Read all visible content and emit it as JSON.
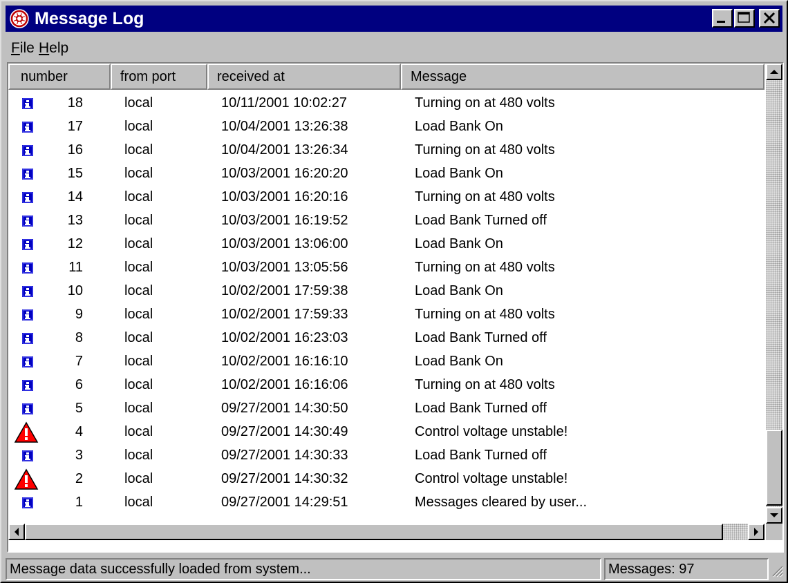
{
  "window": {
    "title": "Message Log"
  },
  "title_buttons": {
    "minimize": "minimize",
    "maximize": "maximize",
    "close": "close"
  },
  "menu": [
    {
      "label": "File",
      "accel": "F",
      "rest": "ile"
    },
    {
      "label": "Help",
      "accel": "H",
      "rest": "elp"
    }
  ],
  "columns": [
    "number",
    "from port",
    "received at",
    "Message"
  ],
  "rows": [
    {
      "icon": "info-icon",
      "number": "18",
      "port": "local",
      "received": "10/11/2001 10:02:27",
      "message": "Turning on at  480 volts"
    },
    {
      "icon": "info-icon",
      "number": "17",
      "port": "local",
      "received": "10/04/2001 13:26:38",
      "message": "Load Bank On"
    },
    {
      "icon": "info-icon",
      "number": "16",
      "port": "local",
      "received": "10/04/2001 13:26:34",
      "message": "Turning on at  480 volts"
    },
    {
      "icon": "info-icon",
      "number": "15",
      "port": "local",
      "received": "10/03/2001 16:20:20",
      "message": "Load Bank On"
    },
    {
      "icon": "info-icon",
      "number": "14",
      "port": "local",
      "received": "10/03/2001 16:20:16",
      "message": "Turning on at  480 volts"
    },
    {
      "icon": "info-icon",
      "number": "13",
      "port": "local",
      "received": "10/03/2001 16:19:52",
      "message": "Load Bank Turned off"
    },
    {
      "icon": "info-icon",
      "number": "12",
      "port": "local",
      "received": "10/03/2001 13:06:00",
      "message": "Load Bank On"
    },
    {
      "icon": "info-icon",
      "number": "11",
      "port": "local",
      "received": "10/03/2001 13:05:56",
      "message": "Turning on at  480 volts"
    },
    {
      "icon": "info-icon",
      "number": "10",
      "port": "local",
      "received": "10/02/2001 17:59:38",
      "message": "Load Bank On"
    },
    {
      "icon": "info-icon",
      "number": "9",
      "port": "local",
      "received": "10/02/2001 17:59:33",
      "message": "Turning on at  480 volts"
    },
    {
      "icon": "info-icon",
      "number": "8",
      "port": "local",
      "received": "10/02/2001 16:23:03",
      "message": "Load Bank Turned off"
    },
    {
      "icon": "info-icon",
      "number": "7",
      "port": "local",
      "received": "10/02/2001 16:16:10",
      "message": "Load Bank On"
    },
    {
      "icon": "info-icon",
      "number": "6",
      "port": "local",
      "received": "10/02/2001 16:16:06",
      "message": "Turning on at  480 volts"
    },
    {
      "icon": "info-icon",
      "number": "5",
      "port": "local",
      "received": "09/27/2001 14:30:50",
      "message": "Load Bank Turned off"
    },
    {
      "icon": "warning-icon",
      "number": "4",
      "port": "local",
      "received": "09/27/2001 14:30:49",
      "message": "Control voltage unstable!"
    },
    {
      "icon": "info-icon",
      "number": "3",
      "port": "local",
      "received": "09/27/2001 14:30:33",
      "message": "Load Bank Turned off"
    },
    {
      "icon": "warning-icon",
      "number": "2",
      "port": "local",
      "received": "09/27/2001 14:30:32",
      "message": "Control voltage unstable!"
    },
    {
      "icon": "info-icon",
      "number": "1",
      "port": "local",
      "received": "09/27/2001 14:29:51",
      "message": "Messages cleared by user..."
    }
  ],
  "status": {
    "message": "Message data successfully loaded from system...",
    "count": "Messages: 97"
  },
  "colors": {
    "titlebar": "#000080",
    "face": "#c0c0c0",
    "info_icon": "#0000c0",
    "warning_icon": "#ff0000"
  }
}
